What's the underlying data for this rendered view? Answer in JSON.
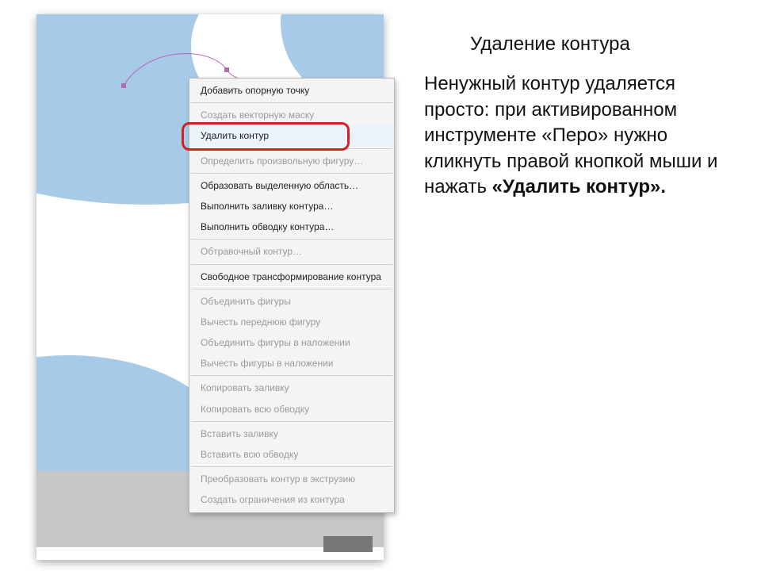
{
  "heading": "Удаление контура",
  "text_part1": "Ненужный контур удаляется просто: при активированном инструменте «Перо» нужно кликнуть правой кнопкой мыши и нажать ",
  "text_bold": "«Удалить контур».",
  "menu": {
    "add_anchor": "Добавить опорную точку",
    "create_vector_mask": "Создать векторную маску",
    "delete_path": "Удалить контур",
    "define_custom_shape": "Определить произвольную фигуру…",
    "make_selection": "Образовать выделенную область…",
    "fill_path": "Выполнить заливку контура…",
    "stroke_path": "Выполнить обводку контура…",
    "clipping_path": "Обтравочный контур…",
    "free_transform_path": "Свободное трансформирование контура",
    "combine_shapes": "Объединить фигуры",
    "subtract_front": "Вычесть переднюю фигуру",
    "intersect_overlap": "Объединить фигуры в наложении",
    "exclude_overlap": "Вычесть фигуры в наложении",
    "copy_fill": "Копировать заливку",
    "copy_stroke": "Копировать всю обводку",
    "paste_fill": "Вставить заливку",
    "paste_stroke": "Вставить всю обводку",
    "extrude_path": "Преобразовать контур в экструзию",
    "create_constraint": "Создать ограничения из контура"
  }
}
